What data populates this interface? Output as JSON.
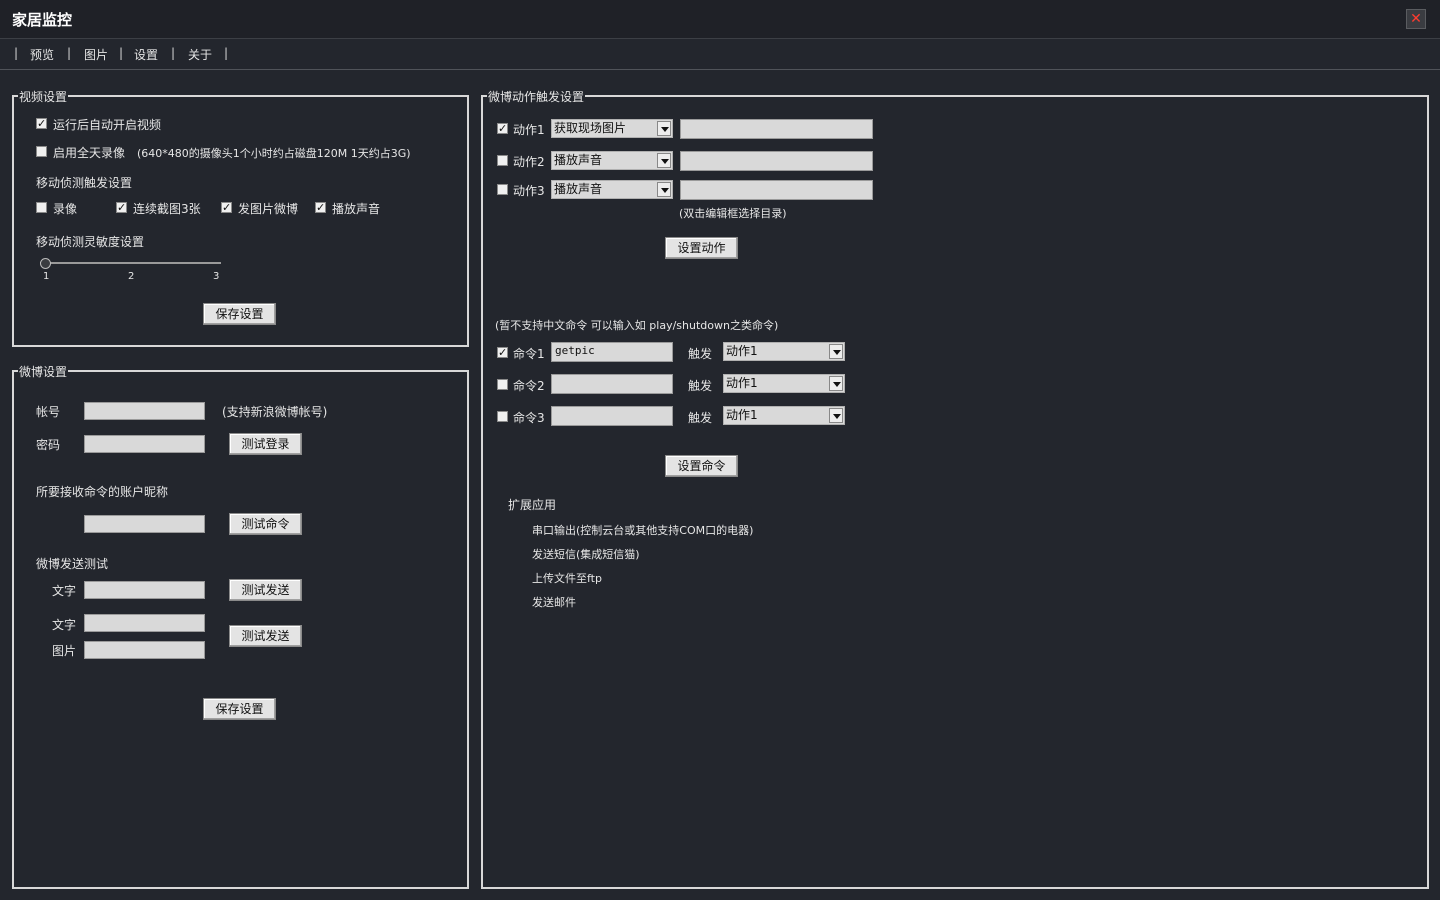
{
  "window": {
    "title": "家居监控",
    "close_glyph": "✕"
  },
  "menu": {
    "items": [
      "预览",
      "图片",
      "设置",
      "关于"
    ],
    "separator": "|"
  },
  "video": {
    "title": "视频设置",
    "auto_start": {
      "label": "运行后自动开启视频",
      "checked": true
    },
    "allday": {
      "label": "启用全天录像",
      "checked": false,
      "note": "(640*480的摄像头1个小时约占磁盘120M 1天约占3G)"
    },
    "motion_trigger_title": "移动侦测触发设置",
    "triggers": [
      {
        "label": "录像",
        "checked": false
      },
      {
        "label": "连续截图3张",
        "checked": true
      },
      {
        "label": "发图片微博",
        "checked": true
      },
      {
        "label": "播放声音",
        "checked": true
      }
    ],
    "sensitivity_title": "移动侦测灵敏度设置",
    "sensitivity_ticks": [
      "1",
      "2",
      "3"
    ],
    "sensitivity_value": 1,
    "save_button": "保存设置"
  },
  "weibo": {
    "title": "微博设置",
    "account_label": "帐号",
    "account_value": "",
    "account_note": "(支持新浪微博帐号)",
    "password_label": "密码",
    "password_value": "",
    "test_login_button": "测试登录",
    "nickname_label": "所要接收命令的账户昵称",
    "nickname_value": "",
    "test_command_button": "测试命令",
    "send_test_title": "微博发送测试",
    "text_label": "文字",
    "test_send_button": "测试发送",
    "text2_label": "文字",
    "image_label": "图片",
    "test_send2_button": "测试发送",
    "save_button": "保存设置"
  },
  "actions": {
    "title": "微博动作触发设置",
    "items": [
      {
        "label": "动作1",
        "checked": true,
        "select": "获取现场图片",
        "path": ""
      },
      {
        "label": "动作2",
        "checked": false,
        "select": "播放声音",
        "path": ""
      },
      {
        "label": "动作3",
        "checked": false,
        "select": "播放声音",
        "path": ""
      }
    ],
    "hint": "(双击编辑框选择目录)",
    "set_button": "设置动作",
    "command_note": "(暂不支持中文命令 可以输入如 play/shutdown之类命令)",
    "trigger_label": "触发",
    "commands": [
      {
        "label": "命令1",
        "checked": true,
        "value": "getpic",
        "trigger": "动作1"
      },
      {
        "label": "命令2",
        "checked": false,
        "value": "",
        "trigger": "动作1"
      },
      {
        "label": "命令3",
        "checked": false,
        "value": "",
        "trigger": "动作1"
      }
    ],
    "set_command_button": "设置命令",
    "ext_title": "扩展应用",
    "ext_items": [
      "串口输出(控制云台或其他支持COM口的电器)",
      "发送短信(集成短信猫)",
      "上传文件至ftp",
      "发送邮件"
    ]
  }
}
